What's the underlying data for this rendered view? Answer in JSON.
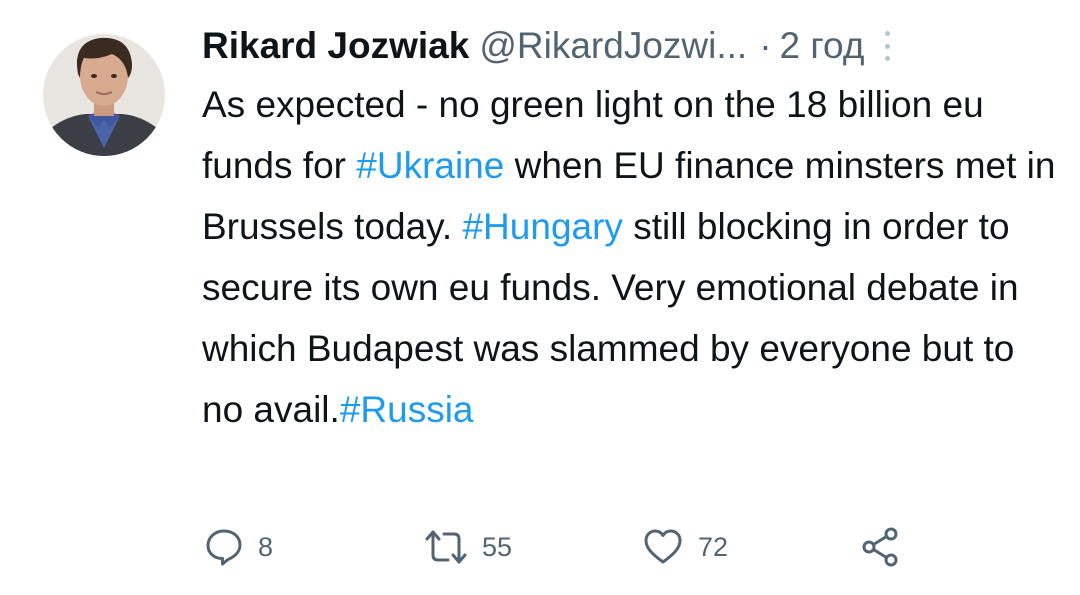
{
  "tweet": {
    "author_name": "Rikard Jozwiak",
    "handle": "@RikardJozwi...",
    "separator": "·",
    "time": "2 год",
    "text": {
      "part1": "As expected - no green light on the 18 billion eu funds for ",
      "tag1": "#Ukraine",
      "part2": " when EU finance minsters met in Brussels today. ",
      "tag2": "#Hungary",
      "part3": " still blocking in order to secure its own eu funds. Very emotional debate in which Budapest was slammed by everyone but to no avail.",
      "tag3": "#Russia"
    },
    "actions": {
      "reply_count": "8",
      "retweet_count": "55",
      "like_count": "72"
    }
  },
  "icons": {
    "reply": "reply-icon",
    "retweet": "retweet-icon",
    "like": "heart-icon",
    "share": "share-icon",
    "more": "more-vertical-icon"
  },
  "colors": {
    "hashtag": "#1d9bf0",
    "secondary_text": "#536471",
    "primary_text": "#0f1419"
  }
}
